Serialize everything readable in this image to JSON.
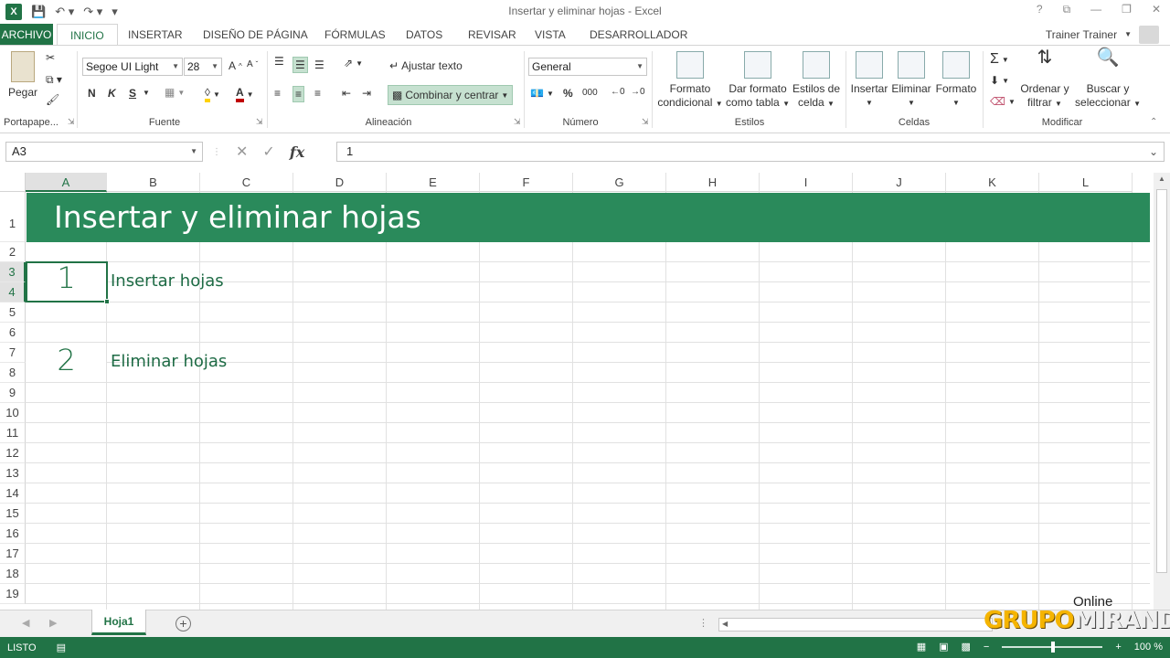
{
  "window": {
    "title": "Insertar y eliminar hojas - Excel",
    "controls": [
      "?",
      "⧉",
      "—",
      "❐",
      "✕"
    ]
  },
  "qat": {
    "logo": "X"
  },
  "tabs": {
    "file": "ARCHIVO",
    "items": [
      "INICIO",
      "INSERTAR",
      "DISEÑO DE PÁGINA",
      "FÓRMULAS",
      "DATOS",
      "REVISAR",
      "VISTA",
      "DESARROLLADOR"
    ],
    "active": "INICIO",
    "user": "Trainer Trainer"
  },
  "ribbon": {
    "clipboard": {
      "paste": "Pegar",
      "label": "Portapape..."
    },
    "font": {
      "name": "Segoe UI Light",
      "size": "28",
      "bold": "N",
      "italic": "K",
      "underline": "S",
      "label": "Fuente"
    },
    "alignment": {
      "wrap": "Ajustar texto",
      "merge": "Combinar y centrar",
      "label": "Alineación"
    },
    "number": {
      "format": "General",
      "percent": "%",
      "thousands": "000",
      "label": "Número"
    },
    "styles": {
      "conditional": [
        "Formato",
        "condicional"
      ],
      "as_table": [
        "Dar formato",
        "como tabla"
      ],
      "cell_styles": [
        "Estilos de",
        "celda"
      ],
      "label": "Estilos"
    },
    "cells": {
      "insert": "Insertar",
      "delete": "Eliminar",
      "format": "Formato",
      "label": "Celdas"
    },
    "editing": {
      "sort": [
        "Ordenar y",
        "filtrar"
      ],
      "find": [
        "Buscar y",
        "seleccionar"
      ],
      "sigma": "Σ",
      "label": "Modificar"
    }
  },
  "formula_bar": {
    "name_box": "A3",
    "fx": "fx",
    "value": "1"
  },
  "grid": {
    "columns": [
      "A",
      "B",
      "C",
      "D",
      "E",
      "F",
      "G",
      "H",
      "I",
      "J",
      "K",
      "L"
    ],
    "rows": [
      "1",
      "2",
      "3",
      "4",
      "5",
      "6",
      "7",
      "8",
      "9",
      "10",
      "11",
      "12",
      "13",
      "14",
      "15",
      "16",
      "17",
      "18",
      "19"
    ],
    "selected_column": "A",
    "selected_rows": [
      "3",
      "4"
    ],
    "banner": "Insertar y eliminar hojas",
    "item1_num": "1",
    "item1_text": "Insertar hojas",
    "item2_num": "2",
    "item2_text": "Eliminar hojas"
  },
  "sheets": {
    "tabs": [
      "Hoja1"
    ],
    "active": "Hoja1",
    "add": "+"
  },
  "status": {
    "state": "LISTO",
    "zoom": "100 %"
  },
  "watermark": {
    "online": "Online",
    "brand_a": "GRUPO",
    "brand_b": "MIRANDA"
  },
  "colors": {
    "accent": "#217346",
    "banner": "#2a8a5b"
  }
}
